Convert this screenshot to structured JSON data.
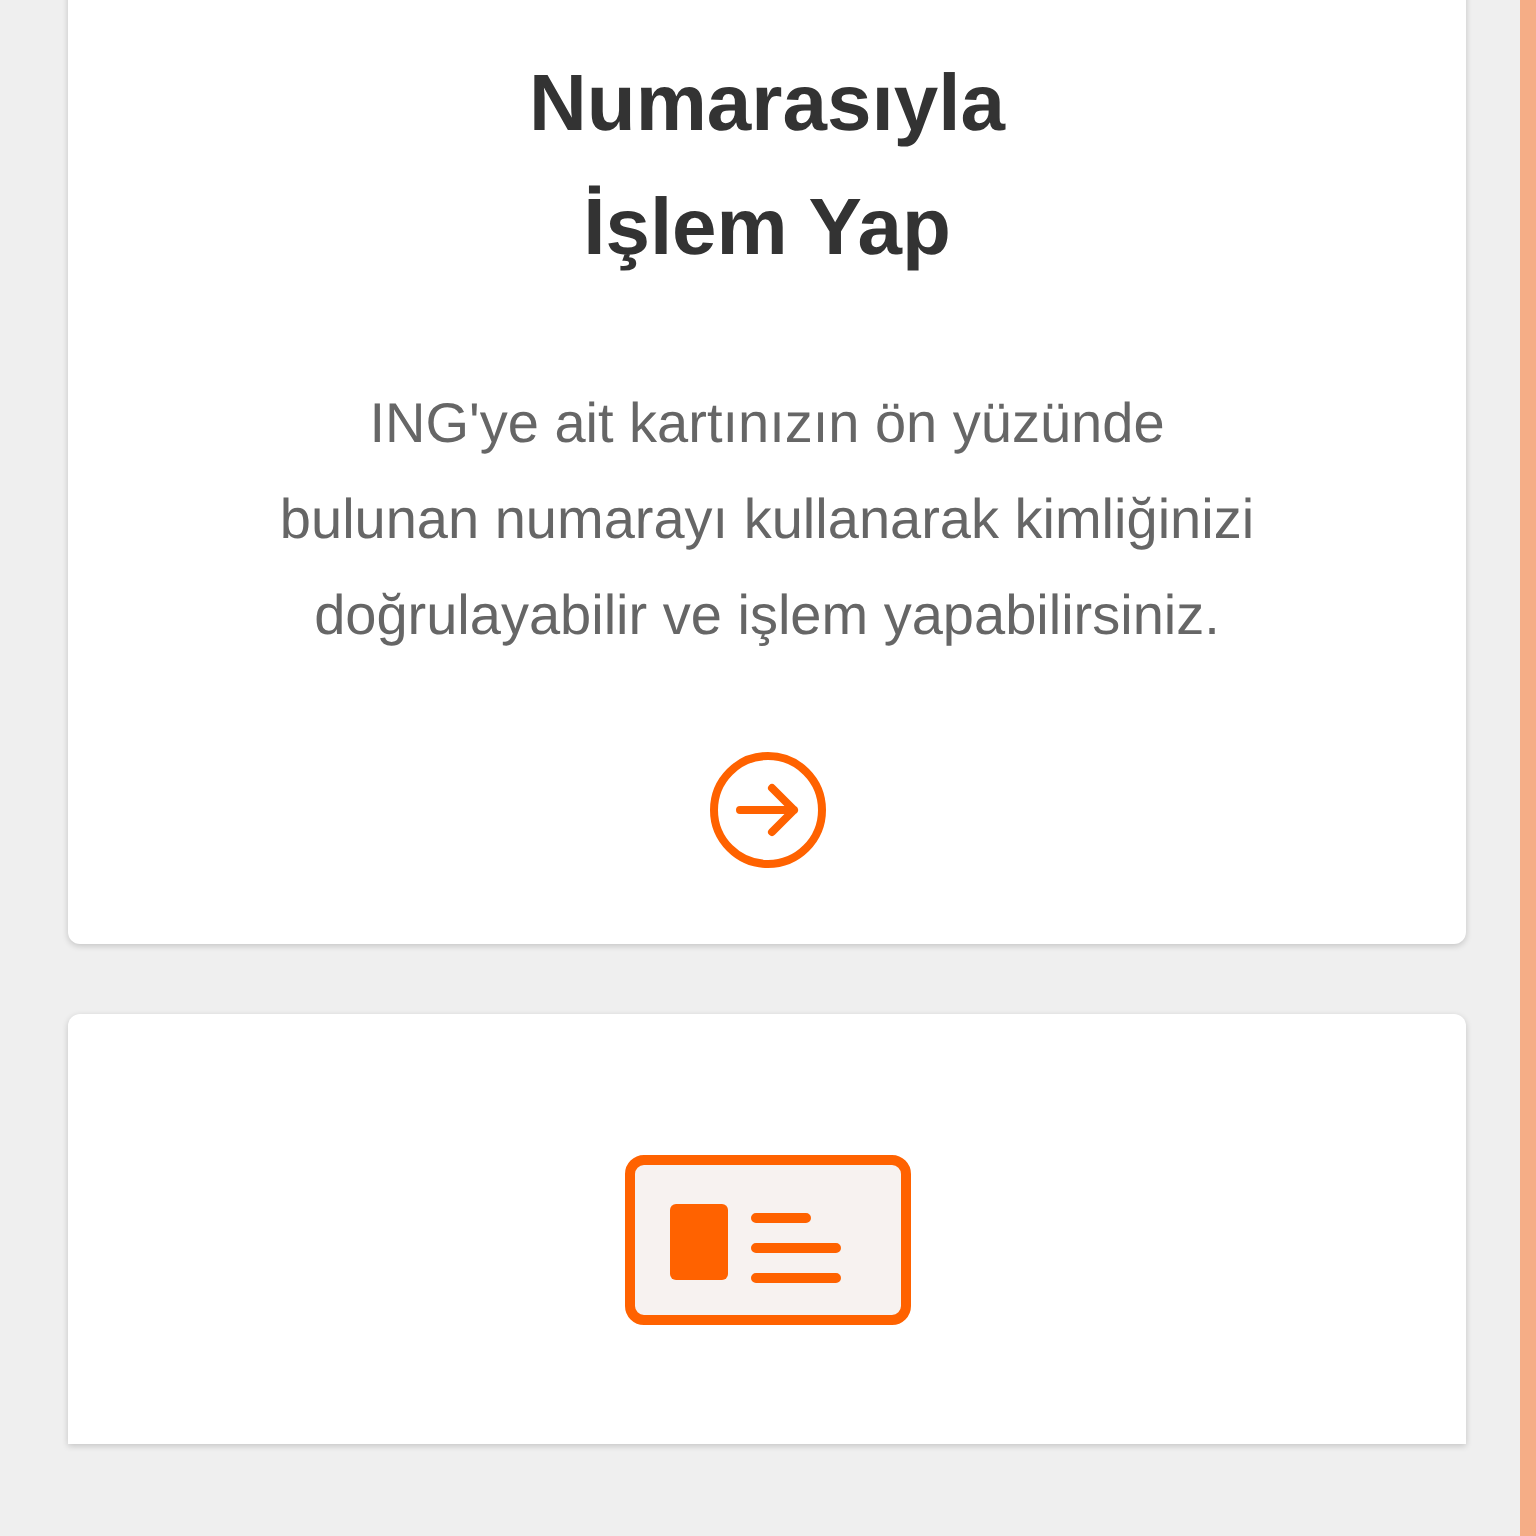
{
  "cards": [
    {
      "title": "Numarasıyla İşlem Yap",
      "description": "ING'ye ait kartınızın ön yüzünde bulunan numarayı kullanarak kimliğinizi doğrulayabilir ve işlem yapabilirsiniz.",
      "kind": "text"
    },
    {
      "kind": "icon"
    }
  ]
}
